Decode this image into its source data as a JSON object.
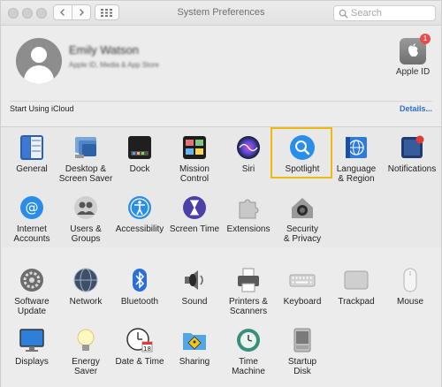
{
  "window": {
    "title": "System Preferences"
  },
  "search": {
    "placeholder": "Search"
  },
  "account": {
    "name": "Emily Watson",
    "subtitle": "Apple ID, Media & App Store",
    "apple_id_label": "Apple ID",
    "badge_count": "1"
  },
  "icloud": {
    "prompt": "Start Using iCloud",
    "details_link": "Details..."
  },
  "row1": [
    {
      "l1": "General",
      "l2": ""
    },
    {
      "l1": "Desktop &",
      "l2": "Screen Saver"
    },
    {
      "l1": "Dock",
      "l2": ""
    },
    {
      "l1": "Mission",
      "l2": "Control"
    },
    {
      "l1": "Siri",
      "l2": ""
    },
    {
      "l1": "Spotlight",
      "l2": ""
    },
    {
      "l1": "Language",
      "l2": "& Region"
    },
    {
      "l1": "Notifications",
      "l2": ""
    }
  ],
  "row2": [
    {
      "l1": "Internet",
      "l2": "Accounts"
    },
    {
      "l1": "Users &",
      "l2": "Groups"
    },
    {
      "l1": "Accessibility",
      "l2": ""
    },
    {
      "l1": "Screen Time",
      "l2": ""
    },
    {
      "l1": "Extensions",
      "l2": ""
    },
    {
      "l1": "Security",
      "l2": "& Privacy"
    }
  ],
  "row3": [
    {
      "l1": "Software",
      "l2": "Update"
    },
    {
      "l1": "Network",
      "l2": ""
    },
    {
      "l1": "Bluetooth",
      "l2": ""
    },
    {
      "l1": "Sound",
      "l2": ""
    },
    {
      "l1": "Printers &",
      "l2": "Scanners"
    },
    {
      "l1": "Keyboard",
      "l2": ""
    },
    {
      "l1": "Trackpad",
      "l2": ""
    },
    {
      "l1": "Mouse",
      "l2": ""
    }
  ],
  "row4": [
    {
      "l1": "Displays",
      "l2": ""
    },
    {
      "l1": "Energy",
      "l2": "Saver"
    },
    {
      "l1": "Date & Time",
      "l2": ""
    },
    {
      "l1": "Sharing",
      "l2": ""
    },
    {
      "l1": "Time",
      "l2": "Machine"
    },
    {
      "l1": "Startup",
      "l2": "Disk"
    }
  ],
  "date_time_icon_day": "18",
  "highlight_color": "#f0b90b",
  "link_color": "#2e6ecf"
}
